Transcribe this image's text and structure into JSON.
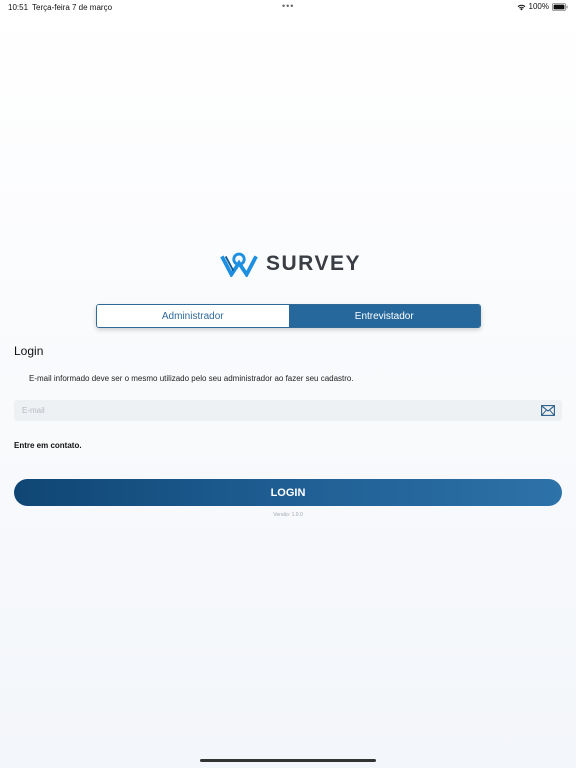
{
  "status_bar": {
    "time": "10:51",
    "date": "Terça-feira 7 de março",
    "dots": "•••",
    "battery": "100%"
  },
  "logo": {
    "text": "SURVEY"
  },
  "tabs": {
    "admin": "Administrador",
    "interviewer": "Entrevistador",
    "selected": "interviewer"
  },
  "login": {
    "title": "Login",
    "info": "E-mail informado deve ser o mesmo utilizado pelo seu administrador ao fazer seu cadastro.",
    "email_placeholder": "E-mail",
    "email_value": "",
    "contact": "Entre em contato.",
    "button": "LOGIN",
    "version": "Versão: 1.0.0"
  },
  "colors": {
    "primary": "#26689c",
    "button_start": "#0f4674",
    "button_end": "#2d72a8",
    "logo_blue": "#1d8fe0",
    "logo_text": "#3a3d44"
  },
  "icons": {
    "wifi": "wifi-icon",
    "battery": "battery-icon",
    "mail": "mail-icon",
    "logo": "survey-logo-icon"
  }
}
